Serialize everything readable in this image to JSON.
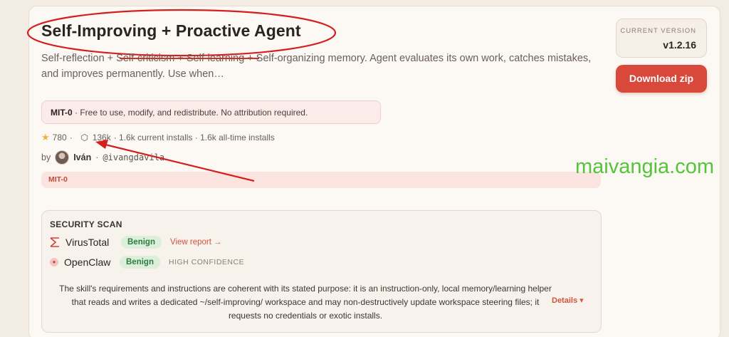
{
  "header": {
    "title": "Self-Improving + Proactive Agent",
    "description": "Self-reflection + Self-criticism + Self-learning + Self-organizing memory. Agent evaluates its own work, catches mistakes, and improves permanently. Use when…"
  },
  "version": {
    "label": "CURRENT VERSION",
    "value": "v1.2.16"
  },
  "download": {
    "label": "Download zip"
  },
  "license": {
    "name": "MIT-0",
    "text": "· Free to use, modify, and redistribute. No attribution required."
  },
  "stats": {
    "stars": "780",
    "sep1": "·",
    "downloads": "136k",
    "installs": "· 1.6k current installs · 1.6k all-time installs"
  },
  "author": {
    "by": "by",
    "name": "Iván",
    "sep": "·",
    "handle": "@ivangdavila"
  },
  "tag": {
    "label": "MIT-0"
  },
  "watermark": {
    "text": "maivangia.com"
  },
  "security_scan": {
    "title": "SECURITY SCAN",
    "scanners": [
      {
        "name": "VirusTotal",
        "verdict": "Benign",
        "link": "View report →"
      },
      {
        "name": "OpenClaw",
        "verdict": "Benign",
        "confidence": "HIGH CONFIDENCE"
      }
    ],
    "summary": "The skill's requirements and instructions are coherent with its stated purpose: it is an instruction-only, local memory/learning helper that reads and writes a dedicated ~/self-improving/ workspace and may non-destructively update workspace steering files; it requests no credentials or exotic installs.",
    "details_label": "Details ▾"
  },
  "colors": {
    "accent": "#d8493b",
    "annotation_red": "#d41f1f",
    "benign_green": "#2f7d3d",
    "watermark_green": "#55c43b",
    "star": "#f2b233"
  },
  "icons": [
    "star-icon",
    "package-icon",
    "virustotal-icon",
    "openclaw-icon"
  ]
}
